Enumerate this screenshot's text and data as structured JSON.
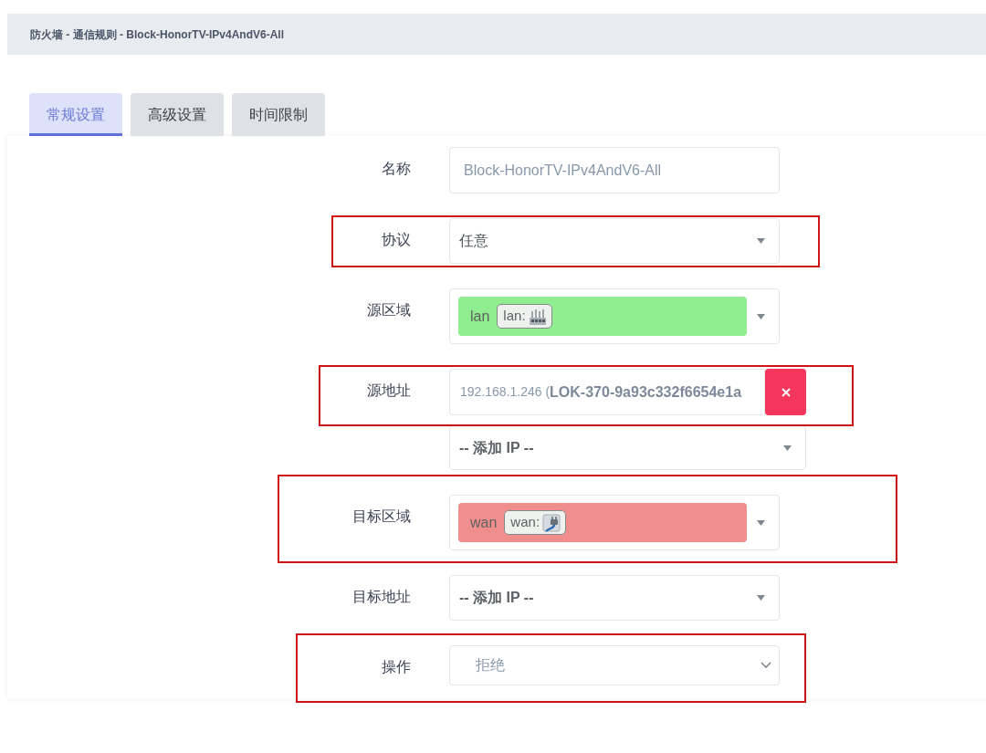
{
  "breadcrumb": "防火墙 - 通信规则 - Block-HonorTV-IPv4AndV6-All",
  "tabs": [
    {
      "label": "常规设置",
      "selected": true
    },
    {
      "label": "高级设置",
      "selected": false
    },
    {
      "label": "时间限制",
      "selected": false
    }
  ],
  "fields": [
    {
      "kind": "text",
      "label": "名称",
      "value": "Block-HonorTV-IPv4AndV6-All",
      "highlighted": false
    },
    {
      "kind": "select",
      "label": "协议",
      "value": "任意",
      "highlighted": true
    },
    {
      "kind": "zone",
      "label": "源区域",
      "zone": {
        "name": "lan",
        "tag": "lan:",
        "color": "#90ee90"
      },
      "highlighted": false
    },
    {
      "kind": "address_list",
      "label": "源地址",
      "entries": [
        "192.168.1.246 (**LOK-370-9a93c332f6654e1a**"
      ],
      "add_placeholder": "-- 添加 IP --",
      "highlighted": true
    },
    {
      "kind": "zone",
      "label": "目标区域",
      "zone": {
        "name": "wan",
        "tag": "wan:",
        "color": "#f08e8e"
      },
      "highlighted": true
    },
    {
      "kind": "address_list",
      "label": "目标地址",
      "add_placeholder": "-- 添加 IP --",
      "highlighted": false
    },
    {
      "kind": "dropdown",
      "label": "操作",
      "value": "拒绝",
      "highlighted": true
    }
  ]
}
